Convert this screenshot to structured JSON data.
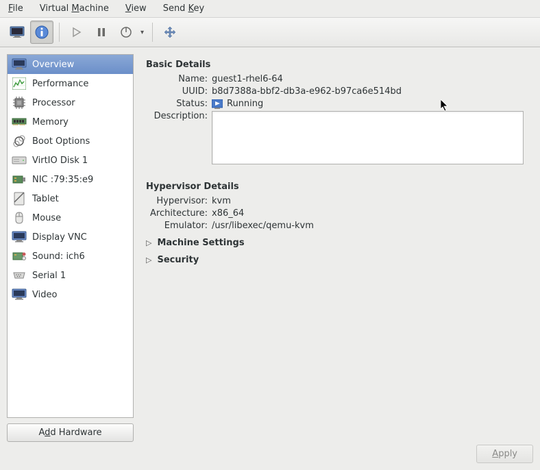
{
  "menu": {
    "file": "File",
    "vm_pre": "Virtual ",
    "vm_u": "M",
    "vm_post": "achine",
    "view_u": "V",
    "view_post": "iew",
    "send_pre": "Send ",
    "send_u": "K",
    "send_post": "ey"
  },
  "sidebar": {
    "items": [
      {
        "label": "Overview",
        "icon": "monitor",
        "selected": true
      },
      {
        "label": "Performance",
        "icon": "perf"
      },
      {
        "label": "Processor",
        "icon": "cpu"
      },
      {
        "label": "Memory",
        "icon": "mem"
      },
      {
        "label": "Boot Options",
        "icon": "boot"
      },
      {
        "label": "VirtIO Disk 1",
        "icon": "disk"
      },
      {
        "label": "NIC :79:35:e9",
        "icon": "nic"
      },
      {
        "label": "Tablet",
        "icon": "tablet"
      },
      {
        "label": "Mouse",
        "icon": "mouse"
      },
      {
        "label": "Display VNC",
        "icon": "monitor"
      },
      {
        "label": "Sound: ich6",
        "icon": "sound"
      },
      {
        "label": "Serial 1",
        "icon": "serial"
      },
      {
        "label": "Video",
        "icon": "monitor"
      }
    ],
    "add_pre": "A",
    "add_u": "d",
    "add_post": "d Hardware"
  },
  "basic": {
    "title": "Basic Details",
    "name_label": "Name:",
    "name_value": "guest1-rhel6-64",
    "uuid_label": "UUID:",
    "uuid_value": "b8d7388a-bbf2-db3a-e962-b97ca6e514bd",
    "status_label": "Status:",
    "status_value": "Running",
    "desc_label": "Description:",
    "desc_value": ""
  },
  "hypervisor": {
    "title": "Hypervisor Details",
    "hv_label": "Hypervisor:",
    "hv_value": "kvm",
    "arch_label": "Architecture:",
    "arch_value": "x86_64",
    "emu_label": "Emulator:",
    "emu_value": "/usr/libexec/qemu-kvm"
  },
  "expanders": {
    "machine": "Machine Settings",
    "security": "Security"
  },
  "apply_u": "A",
  "apply_post": "pply"
}
